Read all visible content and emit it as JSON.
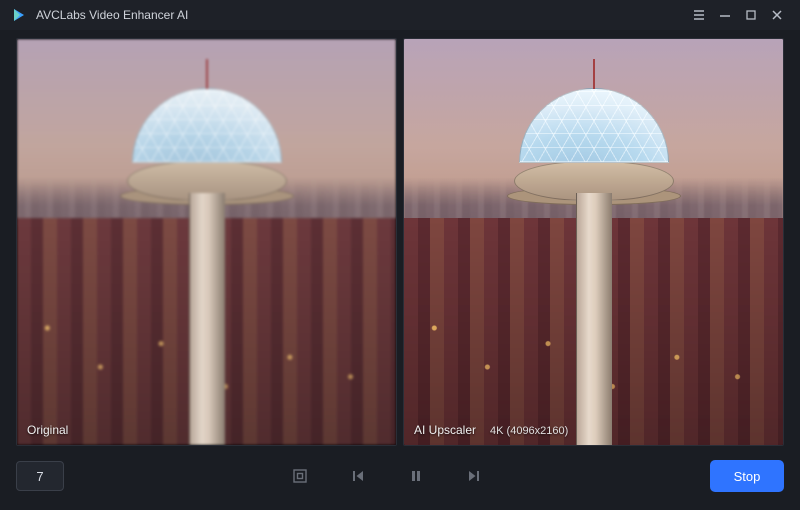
{
  "titlebar": {
    "app_name": "AVCLabs Video Enhancer AI"
  },
  "preview": {
    "left": {
      "label": "Original"
    },
    "right": {
      "label": "AI Upscaler",
      "mode": "4K (4096x2160)"
    }
  },
  "controls": {
    "frame": "7",
    "stop_label": "Stop"
  }
}
